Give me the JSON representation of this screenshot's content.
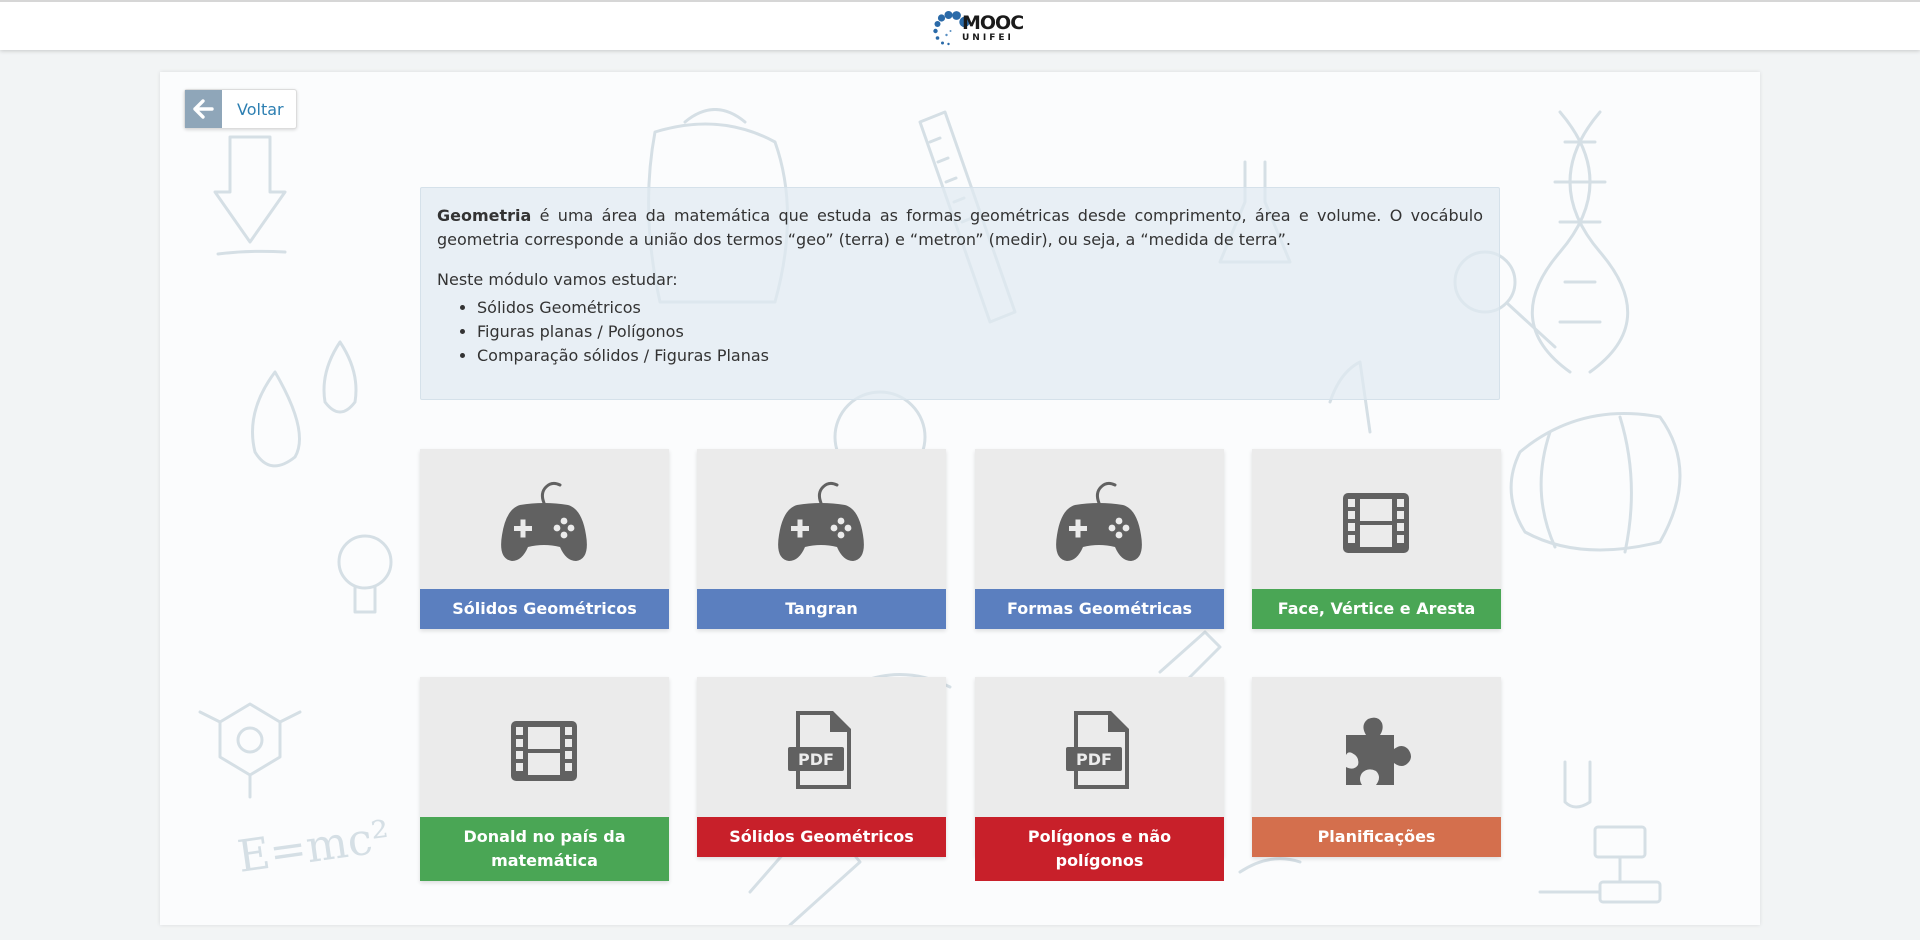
{
  "header": {
    "logo_text_1": "MOOC",
    "logo_text_2": "UNIFEI",
    "logo_icon": "dots-logo-icon"
  },
  "back": {
    "label": "Voltar",
    "icon": "arrow-left-icon"
  },
  "intro": {
    "term": "Geometria",
    "text": " é uma área da matemática que estuda as formas geométricas desde comprimento, área e volume. O vocábulo geometria corresponde a união dos termos “geo” (terra) e “metron” (medir), ou seja, a “medida de terra”.",
    "sub": "Neste módulo vamos estudar:",
    "topics": [
      "Sólidos Geométricos",
      "Figuras planas / Polígonos",
      "Comparação sólidos / Figuras Planas"
    ]
  },
  "cards": [
    {
      "label": "Sólidos Geométricos",
      "icon": "gamepad-icon",
      "color": "#5b7fbf"
    },
    {
      "label": "Tangran",
      "icon": "gamepad-icon",
      "color": "#5b7fbf"
    },
    {
      "label": "Formas Geométricas",
      "icon": "gamepad-icon",
      "color": "#5b7fbf"
    },
    {
      "label": "Face, Vértice e Aresta",
      "icon": "film-icon",
      "color": "#4aa655"
    },
    {
      "label": "Donald no país da matemática",
      "icon": "film-icon",
      "color": "#4aa655"
    },
    {
      "label": "Sólidos Geométricos",
      "icon": "pdf-icon",
      "color": "#c8202a"
    },
    {
      "label": "Polígonos e não polígonos",
      "icon": "pdf-icon",
      "color": "#c8202a"
    },
    {
      "label": "Planificações",
      "icon": "puzzle-icon",
      "color": "#d46f4d"
    }
  ],
  "colors": {
    "icon": "#616161",
    "card_bg": "#ebebeb",
    "link": "#2d7fb2"
  }
}
